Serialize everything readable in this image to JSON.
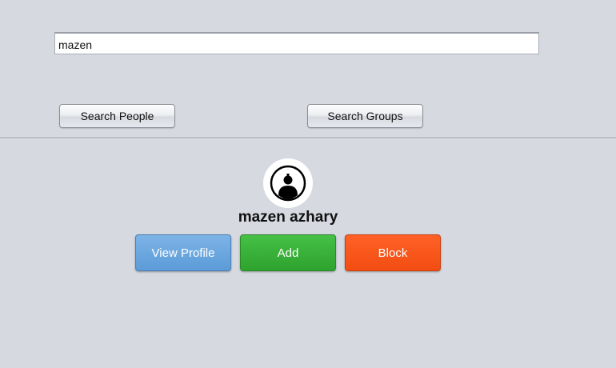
{
  "search": {
    "value": "mazen",
    "people_button_label": "Search People",
    "groups_button_label": "Search Groups"
  },
  "result": {
    "avatar_icon": "user-avatar-icon",
    "name": "mazen azhary",
    "buttons": {
      "view_profile_label": "View Profile",
      "add_label": "Add",
      "block_label": "Block"
    }
  },
  "colors": {
    "background": "#d6d9e0",
    "view_profile": "#5b9bd8",
    "add": "#2ea32e",
    "block": "#f24d12"
  }
}
